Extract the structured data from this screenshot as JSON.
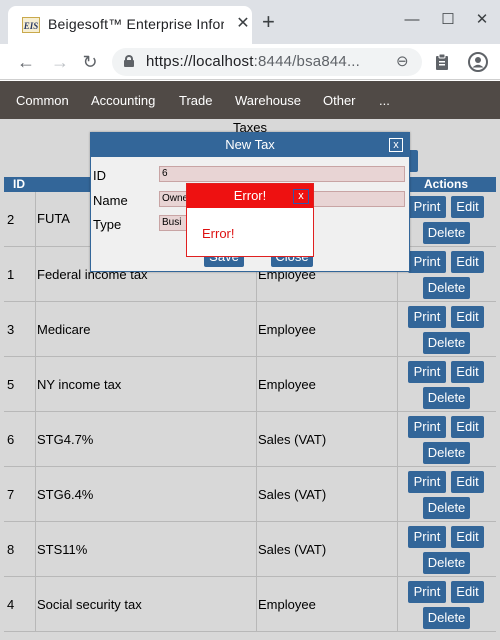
{
  "browser": {
    "tab_title": "Beigesoft™ Enterprise Information",
    "favicon_text": "EIS",
    "url_host": "https://localhost",
    "url_rest": ":8444/bsa844...",
    "icons": [
      "close-icon",
      "plus-icon",
      "minimize-icon",
      "maximize-icon",
      "back-icon",
      "forward-icon",
      "reload-icon",
      "lock-icon",
      "zoom-icon",
      "clipboard-icon",
      "profile-icon"
    ]
  },
  "menu": {
    "items": [
      "Common",
      "Accounting",
      "Trade",
      "Warehouse",
      "Other",
      "..."
    ]
  },
  "page": {
    "title": "Taxes",
    "headers": {
      "id": "ID",
      "actions": "Actions"
    },
    "button_labels": {
      "print": "Print",
      "edit": "Edit",
      "delete": "Delete"
    },
    "rows": [
      {
        "id": "2",
        "name": "FUTA",
        "type": ""
      },
      {
        "id": "1",
        "name": "Federal income tax",
        "type": "Employee"
      },
      {
        "id": "3",
        "name": "Medicare",
        "type": "Employee"
      },
      {
        "id": "5",
        "name": "NY income tax",
        "type": "Employee"
      },
      {
        "id": "6",
        "name": "STG4.7%",
        "type": "Sales (VAT)"
      },
      {
        "id": "7",
        "name": "STG6.4%",
        "type": "Sales (VAT)"
      },
      {
        "id": "8",
        "name": "STS11%",
        "type": "Sales (VAT)"
      },
      {
        "id": "4",
        "name": "Social security tax",
        "type": "Employee"
      }
    ]
  },
  "new_tax_dialog": {
    "title": "New Tax",
    "close_label": "x",
    "id_label": "ID",
    "id_value": "6",
    "name_label": "Name",
    "name_value": "Owne",
    "type_label": "Type",
    "type_value": "Busi",
    "save_label": "Save",
    "close_button_label": "Close"
  },
  "error_dialog": {
    "title": "Error!",
    "close_label": "x",
    "message": "Error!"
  },
  "colors": {
    "accent": "#336699",
    "menu_bg": "#504a46",
    "error": "#ee1111"
  }
}
